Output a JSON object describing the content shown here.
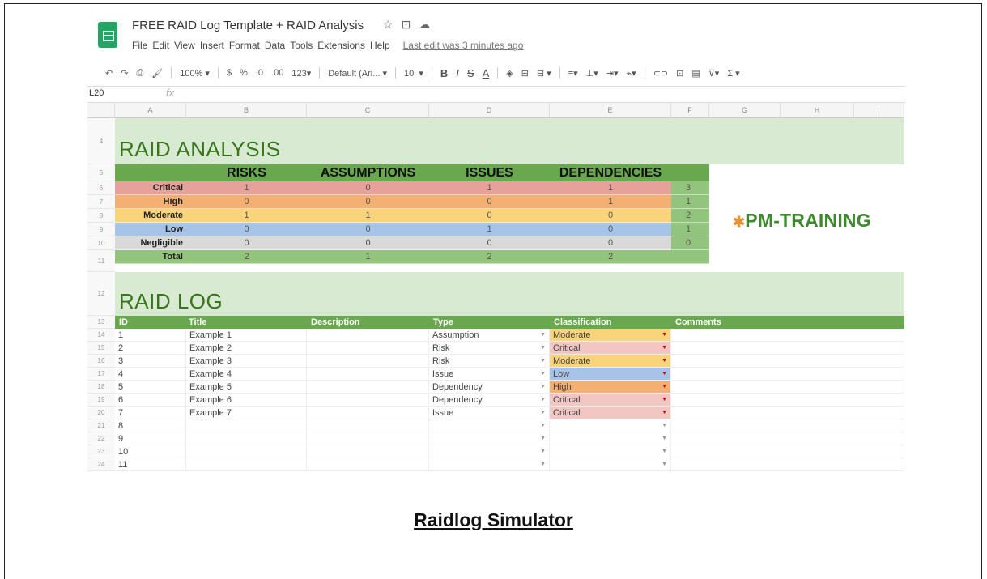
{
  "app": {
    "doc_title": "FREE RAID Log Template + RAID Analysis",
    "menu": [
      "File",
      "Edit",
      "View",
      "Insert",
      "Format",
      "Data",
      "Tools",
      "Extensions",
      "Help"
    ],
    "last_edit": "Last edit was 3 minutes ago"
  },
  "toolbar": {
    "zoom": "100%",
    "currency": "$",
    "percent": "%",
    "dec_decrease": ".0",
    "dec_increase": ".00",
    "format_123": "123",
    "font": "Default (Ari...",
    "font_size": "10",
    "bold": "B",
    "italic": "I",
    "strike": "S",
    "text_color": "A"
  },
  "formula_bar": {
    "cell_ref": "L20",
    "fx": "fx"
  },
  "columns": [
    "A",
    "B",
    "C",
    "D",
    "E",
    "F",
    "G",
    "H",
    "I"
  ],
  "row_numbers": [
    "4",
    "5",
    "6",
    "7",
    "8",
    "9",
    "10",
    "11",
    "12",
    "13",
    "14",
    "15",
    "16",
    "17",
    "18",
    "19",
    "20",
    "21",
    "22",
    "23",
    "24"
  ],
  "analysis": {
    "title": "RAID  ANALYSIS",
    "headers": [
      "RISKS",
      "ASSUMPTIONS",
      "ISSUES",
      "DEPENDENCIES"
    ],
    "rows": [
      {
        "label": "Critical",
        "values": [
          "1",
          "0",
          "1",
          "1"
        ],
        "total": "3",
        "color": "#e6a19b"
      },
      {
        "label": "High",
        "values": [
          "0",
          "0",
          "0",
          "1"
        ],
        "total": "1",
        "color": "#f3b072"
      },
      {
        "label": "Moderate",
        "values": [
          "1",
          "1",
          "0",
          "0"
        ],
        "total": "2",
        "color": "#fad47a"
      },
      {
        "label": "Low",
        "values": [
          "0",
          "0",
          "1",
          "0"
        ],
        "total": "1",
        "color": "#a7c4e8"
      },
      {
        "label": "Negligible",
        "values": [
          "0",
          "0",
          "0",
          "0"
        ],
        "total": "0",
        "color": "#d9d9d9"
      }
    ],
    "total_row": {
      "label": "Total",
      "values": [
        "2",
        "1",
        "2",
        "2"
      ],
      "color": "#93c47d"
    }
  },
  "logo": {
    "mark": "✱",
    "text": "PM-TRAINING"
  },
  "log": {
    "title": "RAID  LOG",
    "headers": [
      "ID",
      "Title",
      "Description",
      "Type",
      "Classification",
      "Comments"
    ],
    "rows": [
      {
        "id": "1",
        "title": "Example 1",
        "type": "Assumption",
        "classification": "Moderate",
        "color": "#fad47a"
      },
      {
        "id": "2",
        "title": "Example 2",
        "type": "Risk",
        "classification": "Critical",
        "color": "#f2c6c2"
      },
      {
        "id": "3",
        "title": "Example 3",
        "type": "Risk",
        "classification": "Moderate",
        "color": "#fad47a"
      },
      {
        "id": "4",
        "title": "Example 4",
        "type": "Issue",
        "classification": "Low",
        "color": "#a7c4e8"
      },
      {
        "id": "5",
        "title": "Example 5",
        "type": "Dependency",
        "classification": "High",
        "color": "#f3b072"
      },
      {
        "id": "6",
        "title": "Example 6",
        "type": "Dependency",
        "classification": "Critical",
        "color": "#f2c6c2"
      },
      {
        "id": "7",
        "title": "Example 7",
        "type": "Issue",
        "classification": "Critical",
        "color": "#f2c6c2"
      },
      {
        "id": "8",
        "title": "",
        "type": "",
        "classification": "",
        "color": ""
      },
      {
        "id": "9",
        "title": "",
        "type": "",
        "classification": "",
        "color": ""
      },
      {
        "id": "10",
        "title": "",
        "type": "",
        "classification": "",
        "color": ""
      },
      {
        "id": "11",
        "title": "",
        "type": "",
        "classification": "",
        "color": ""
      }
    ]
  },
  "caption": "Raidlog Simulator"
}
